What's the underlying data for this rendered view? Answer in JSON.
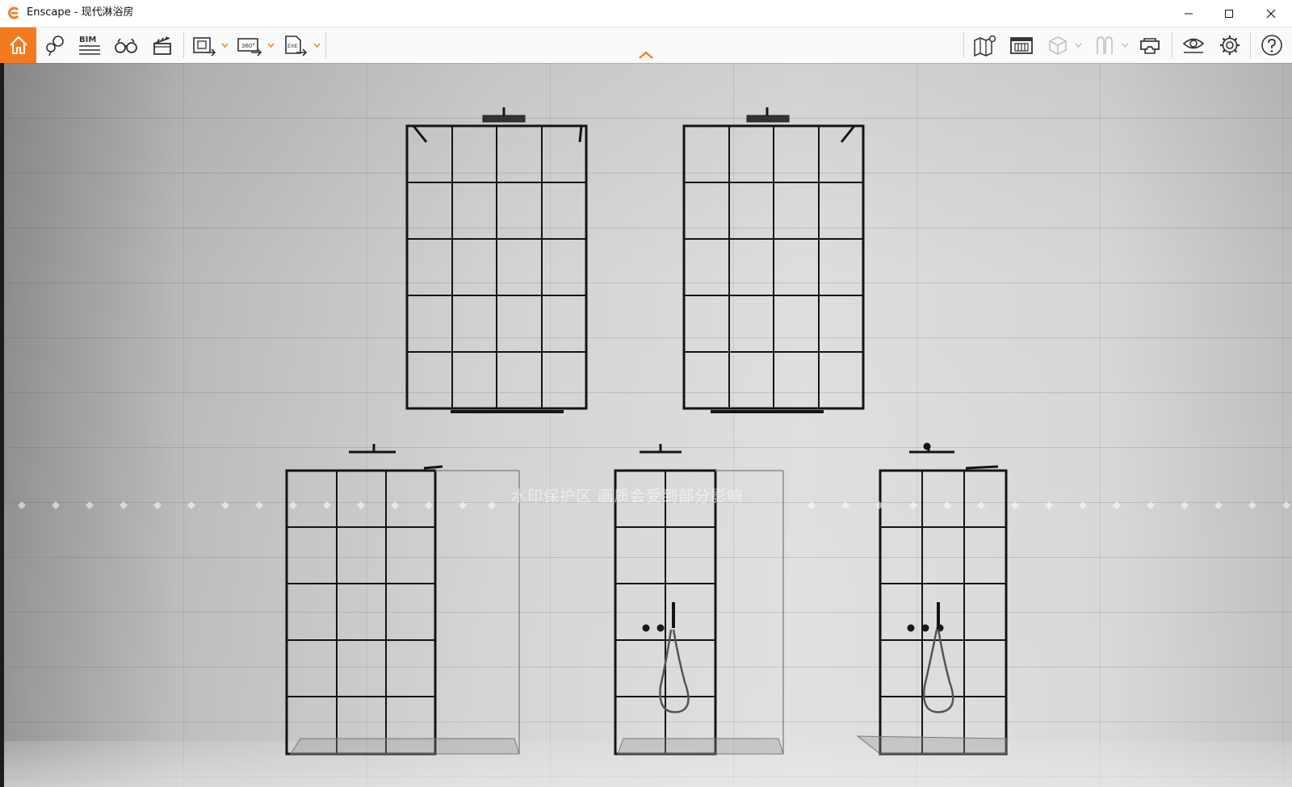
{
  "window": {
    "title": "Enscape - 现代淋浴房",
    "brand_color": "#f47a1f"
  },
  "toolbar": {
    "left_items": [
      {
        "name": "home-icon",
        "active": true
      },
      {
        "name": "views-pin-icon"
      },
      {
        "name": "bim-icon",
        "label": "BIM"
      },
      {
        "name": "binoculars-icon"
      },
      {
        "name": "clapperboard-icon"
      },
      {
        "name": "screenshot-export-icon"
      },
      {
        "name": "panorama-360-export-icon",
        "label": "360°"
      },
      {
        "name": "exe-export-icon",
        "label": "EXE"
      }
    ],
    "right_items": [
      {
        "name": "map-icon"
      },
      {
        "name": "asset-library-icon"
      },
      {
        "name": "cube-view-icon",
        "disabled": true
      },
      {
        "name": "sections-icon",
        "disabled": true
      },
      {
        "name": "vr-headset-icon"
      },
      {
        "name": "visual-settings-icon"
      },
      {
        "name": "gear-icon"
      },
      {
        "name": "help-icon"
      }
    ]
  },
  "viewport": {
    "watermark": "水印保护区   画质会受到部分影响"
  }
}
